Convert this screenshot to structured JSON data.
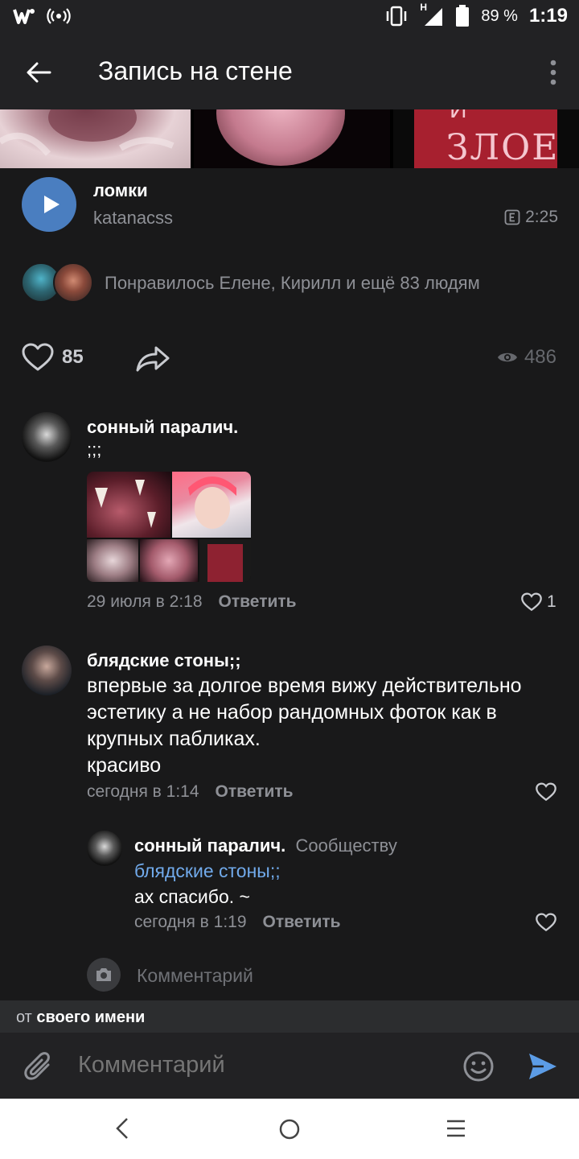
{
  "status_bar": {
    "battery": "89 %",
    "time": "1:19",
    "network": "H"
  },
  "header": {
    "title": "Запись на стене"
  },
  "photo_strip": {
    "sign_text": "ЗЛОЕ",
    "sign_top": "И"
  },
  "audio": {
    "title": "ломки",
    "artist": "katanacss",
    "duration": "2:25"
  },
  "likes": {
    "liked_by_text": "Понравилось Елене, Кирилл и ещё 83 людям",
    "count": "85",
    "views": "486"
  },
  "comments": [
    {
      "author": "сонный паралич.",
      "text": ";;;",
      "date": "29 июля в 2:18",
      "reply_label": "Ответить",
      "likes": "1"
    },
    {
      "author": "блядские стоны;;",
      "text": "впервые за долгое время вижу действительно эстетику а не набор рандомных фоток как в крупных пабликах.\nкрасиво",
      "date": "сегодня в 1:14",
      "reply_label": "Ответить"
    },
    {
      "author": "сонный паралич.",
      "to_label": "Сообществу",
      "mention": "блядские стоны;;",
      "text": "ах спасибо. ~",
      "date": "сегодня в 1:19",
      "reply_label": "Ответить"
    }
  ],
  "comment_hint": "Комментарий",
  "from_bar": {
    "prefix": "от",
    "name": "своего имени"
  },
  "input": {
    "placeholder": "Комментарий"
  },
  "icons": {
    "back": "back-arrow-icon",
    "more": "more-vertical-icon",
    "play": "play-icon",
    "like": "heart-icon",
    "share": "share-icon",
    "views": "eye-icon",
    "camera": "camera-icon",
    "attach": "paperclip-icon",
    "emoji": "smile-icon",
    "send": "send-icon"
  },
  "colors": {
    "accent": "#4a7ec0",
    "mention": "#71aaeb",
    "background": "#19191a"
  }
}
